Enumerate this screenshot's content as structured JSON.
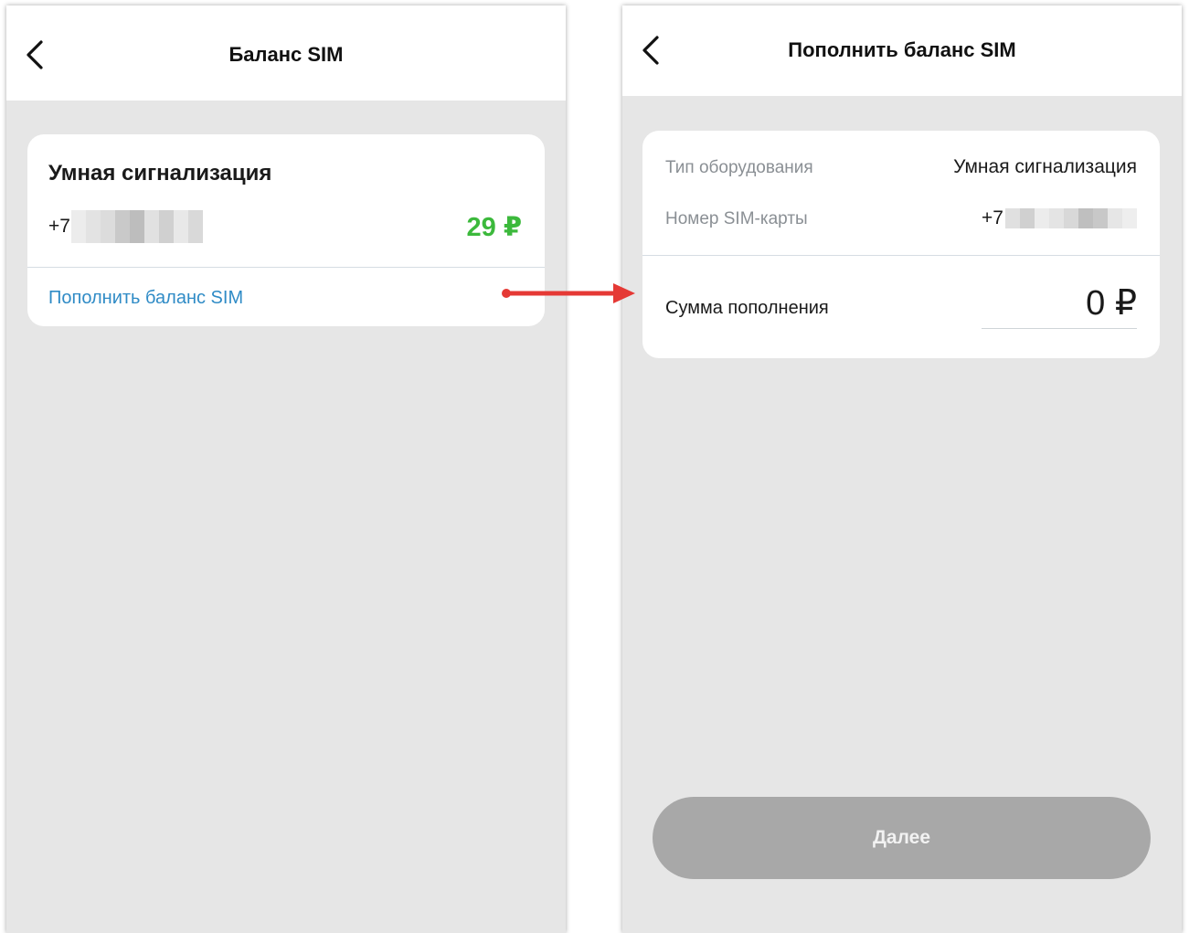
{
  "left_screen": {
    "title": "Баланс SIM",
    "card": {
      "device_name": "Умная сигнализация",
      "phone_prefix": "+7",
      "balance": "29 ₽",
      "topup_link": "Пополнить баланс SIM"
    }
  },
  "right_screen": {
    "title": "Пополнить баланс SIM",
    "equipment_type_label": "Тип оборудования",
    "equipment_type_value": "Умная сигнализация",
    "sim_number_label": "Номер SIM-карты",
    "sim_number_value": "+7",
    "amount_label": "Сумма пополнения",
    "amount_value": "0 ₽",
    "next_button": "Далее"
  },
  "colors": {
    "balance_green": "#3cb93c",
    "link_blue": "#2f8bc6",
    "arrow_red": "#e53935",
    "button_disabled": "#a8a8a8",
    "background_gray": "#e6e6e6"
  },
  "icons": {
    "back": "chevron-left-icon",
    "annotation_arrow": "red-arrow-icon"
  }
}
